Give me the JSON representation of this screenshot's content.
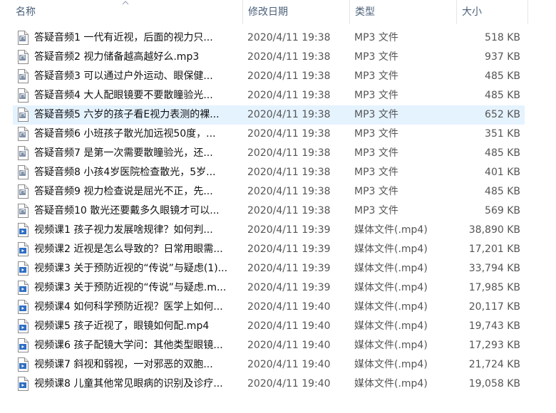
{
  "columns": {
    "name": "名称",
    "date": "修改日期",
    "type": "类型",
    "size": "大小"
  },
  "sort": {
    "column": "name",
    "direction": "ascending"
  },
  "selected_row_index": 4,
  "colors": {
    "header_text": "#4c607a",
    "selection": "#e5f3ff"
  },
  "files": [
    {
      "name": "答疑音频1   一代有近视，后面的视力只...",
      "date": "2020/4/11 19:38",
      "type": "MP3 文件",
      "size": "518 KB",
      "icon": "audio-file-icon"
    },
    {
      "name": "答疑音频2   视力储备越高越好么.mp3",
      "date": "2020/4/11 19:38",
      "type": "MP3 文件",
      "size": "937 KB",
      "icon": "audio-file-icon"
    },
    {
      "name": "答疑音频3  可以通过户外运动、眼保健...",
      "date": "2020/4/11 19:38",
      "type": "MP3 文件",
      "size": "485 KB",
      "icon": "audio-file-icon"
    },
    {
      "name": "答疑音频4  大人配眼镜要不要散瞳验光...",
      "date": "2020/4/11 19:38",
      "type": "MP3 文件",
      "size": "485 KB",
      "icon": "audio-file-icon"
    },
    {
      "name": "答疑音频5  六岁的孩子看E视力表测的裸...",
      "date": "2020/4/11 19:38",
      "type": "MP3 文件",
      "size": "652 KB",
      "icon": "audio-file-icon"
    },
    {
      "name": "答疑音频6  小班孩子散光加远视50度，...",
      "date": "2020/4/11 19:38",
      "type": "MP3 文件",
      "size": "351 KB",
      "icon": "audio-file-icon"
    },
    {
      "name": "答疑音频7   是第一次需要散瞳验光，还...",
      "date": "2020/4/11 19:38",
      "type": "MP3 文件",
      "size": "485 KB",
      "icon": "audio-file-icon"
    },
    {
      "name": "答疑音频8  小孩4岁医院检查散光，5岁...",
      "date": "2020/4/11 19:38",
      "type": "MP3 文件",
      "size": "401 KB",
      "icon": "audio-file-icon"
    },
    {
      "name": "答疑音频9  视力检查说是屈光不正，先...",
      "date": "2020/4/11 19:38",
      "type": "MP3 文件",
      "size": "485 KB",
      "icon": "audio-file-icon"
    },
    {
      "name": "答疑音频10  散光还要戴多久眼镜才可以...",
      "date": "2020/4/11 19:38",
      "type": "MP3 文件",
      "size": "569 KB",
      "icon": "audio-file-icon"
    },
    {
      "name": "视频课1  孩子视力发展啥规律？如何判...",
      "date": "2020/4/11 19:39",
      "type": "媒体文件(.mp4)",
      "size": "38,890 KB",
      "icon": "video-file-icon"
    },
    {
      "name": "视频课2 近视是怎么导致的？日常用眼需...",
      "date": "2020/4/11 19:39",
      "type": "媒体文件(.mp4)",
      "size": "17,201 KB",
      "icon": "video-file-icon"
    },
    {
      "name": "视频课3 关于预防近视的“传说”与疑虑(1)...",
      "date": "2020/4/11 19:39",
      "type": "媒体文件(.mp4)",
      "size": "33,794 KB",
      "icon": "video-file-icon"
    },
    {
      "name": "视频课3 关于预防近视的“传说”与疑虑.m...",
      "date": "2020/4/11 19:39",
      "type": "媒体文件(.mp4)",
      "size": "17,985 KB",
      "icon": "video-file-icon"
    },
    {
      "name": "视频课4 如何科学预防近视？医学上如何...",
      "date": "2020/4/11 19:40",
      "type": "媒体文件(.mp4)",
      "size": "20,117 KB",
      "icon": "video-file-icon"
    },
    {
      "name": "视频课5 孩子近视了，眼镜如何配.mp4",
      "date": "2020/4/11 19:40",
      "type": "媒体文件(.mp4)",
      "size": "19,743 KB",
      "icon": "video-file-icon"
    },
    {
      "name": "视频课6 孩子配镜大学问：其他类型眼镜...",
      "date": "2020/4/11 19:40",
      "type": "媒体文件(.mp4)",
      "size": "17,293 KB",
      "icon": "video-file-icon"
    },
    {
      "name": "视频课7  斜视和弱视，一对邪恶的双胞...",
      "date": "2020/4/11 19:40",
      "type": "媒体文件(.mp4)",
      "size": "21,724 KB",
      "icon": "video-file-icon"
    },
    {
      "name": "视频课8 儿童其他常见眼病的识别及诊疗...",
      "date": "2020/4/11 19:40",
      "type": "媒体文件(.mp4)",
      "size": "19,058 KB",
      "icon": "video-file-icon"
    }
  ]
}
